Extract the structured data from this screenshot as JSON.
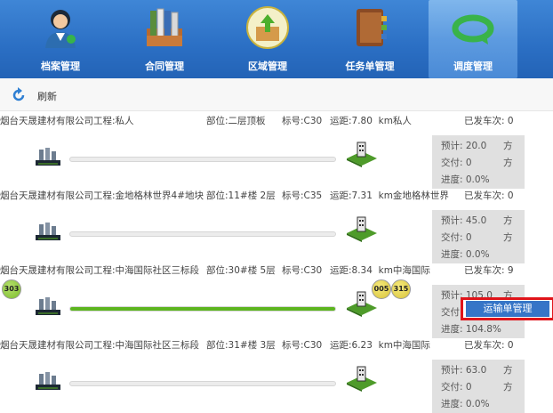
{
  "nav": {
    "tabs": [
      {
        "label": "档案管理",
        "icon": "user-profile-icon"
      },
      {
        "label": "合同管理",
        "icon": "binders-icon"
      },
      {
        "label": "区域管理",
        "icon": "upload-box-icon"
      },
      {
        "label": "任务单管理",
        "icon": "notebook-icon"
      },
      {
        "label": "调度管理",
        "icon": "rotate-arrow-icon"
      }
    ],
    "active_tab": "调度管理"
  },
  "toolbar": {
    "refresh_label": "刷新"
  },
  "tasks": [
    {
      "company": "烟台天晟建材有限公司",
      "project": "工程:私人",
      "part": "部位:二层顶板",
      "grade": "标号:C30",
      "distance": "运距:7.80",
      "distance_unit": "km私人",
      "sent": "已发车次: 0",
      "planned": "预计: 20.0",
      "planned_unit": "方",
      "delivered": "交付: 0",
      "delivered_unit": "方",
      "progress": "进度: 0.0%",
      "progress_value": 0
    },
    {
      "company": "烟台天晟建材有限公司",
      "project": "工程:金地格林世界4#地块",
      "part": "部位:11#楼 2层",
      "grade": "标号:C35",
      "distance": "运距:7.31",
      "distance_unit": "km金地格林世界",
      "sent": "已发车次: 0",
      "planned": "预计: 45.0",
      "planned_unit": "方",
      "delivered": "交付: 0",
      "delivered_unit": "方",
      "progress": "进度: 0.0%",
      "progress_value": 0
    },
    {
      "company": "烟台天晟建材有限公司",
      "project": "工程:中海国际社区三标段",
      "part": "部位:30#楼 5层",
      "grade": "标号:C30",
      "distance": "运距:8.34",
      "distance_unit": "km中海国际",
      "sent": "已发车次: 9",
      "planned": "预计: 105.0",
      "planned_unit": "方",
      "delivered": "交付",
      "delivered_unit": "",
      "progress": "进度: 104.8%",
      "progress_value": 100,
      "trucks": [
        "303",
        "005",
        "315"
      ]
    },
    {
      "company": "烟台天晟建材有限公司",
      "project": "工程:中海国际社区三标段",
      "part": "部位:31#楼 3层",
      "grade": "标号:C30",
      "distance": "运距:6.23",
      "distance_unit": "km中海国际",
      "sent": "已发车次: 0",
      "planned": "预计: 63.0",
      "planned_unit": "方",
      "delivered": "交付: 0",
      "delivered_unit": "方",
      "progress": "进度: 0.0%",
      "progress_value": 0
    }
  ],
  "context_menu": {
    "item": "运输单管理"
  },
  "colors": {
    "nav": "#2b6fc4",
    "progress": "#5cb51f",
    "highlight": "#e0141a",
    "menu": "#3675c7"
  }
}
